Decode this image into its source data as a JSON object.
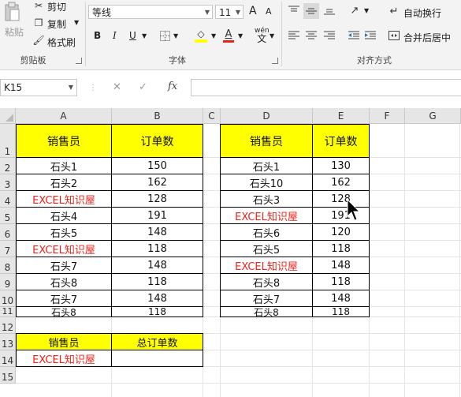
{
  "ribbon": {
    "clipboard": {
      "paste": "粘贴",
      "cut": "剪切",
      "copy": "复制",
      "format_painter": "格式刷",
      "group": "剪贴板"
    },
    "font": {
      "name": "等线",
      "size": "11",
      "bold": "B",
      "italic": "I",
      "underline": "U",
      "grow": "A",
      "shrink": "A",
      "wen": "wén",
      "wen_char": "文",
      "group": "字体"
    },
    "alignment": {
      "wrap": "自动换行",
      "merge": "合并后居中",
      "group": "对齐方式"
    },
    "colors": {
      "fill": "#ffff00",
      "font": "#e8231b"
    }
  },
  "formula_bar": {
    "name_box": "K15",
    "fx": "fx",
    "cancel": "✕",
    "enter": "✓",
    "value": ""
  },
  "columns": [
    "A",
    "B",
    "C",
    "D",
    "E",
    "F",
    "G"
  ],
  "rows": [
    "1",
    "2",
    "3",
    "4",
    "5",
    "6",
    "7",
    "8",
    "9",
    "10",
    "11",
    "12",
    "13",
    "14",
    "15"
  ],
  "table1": {
    "headers": [
      "销售员",
      "订单数"
    ],
    "rows": [
      [
        "石头1",
        "150"
      ],
      [
        "石头2",
        "162"
      ],
      [
        "EXCEL知识屋",
        "128"
      ],
      [
        "石头4",
        "191"
      ],
      [
        "石头5",
        "148"
      ],
      [
        "EXCEL知识屋",
        "118"
      ],
      [
        "石头7",
        "148"
      ],
      [
        "石头8",
        "118"
      ],
      [
        "石头7",
        "148"
      ],
      [
        "石头8",
        "118"
      ]
    ]
  },
  "table2": {
    "headers": [
      "销售员",
      "订单数"
    ],
    "rows": [
      [
        "石头1",
        "130"
      ],
      [
        "石头10",
        "162"
      ],
      [
        "石头3",
        "128"
      ],
      [
        "EXCEL知识屋",
        "191"
      ],
      [
        "石头6",
        "120"
      ],
      [
        "石头5",
        "118"
      ],
      [
        "EXCEL知识屋",
        "148"
      ],
      [
        "石头8",
        "118"
      ],
      [
        "石头7",
        "148"
      ],
      [
        "石头8",
        "118"
      ]
    ]
  },
  "lookup": {
    "headers": [
      "销售员",
      "总订单数"
    ],
    "name": "EXCEL知识屋",
    "total": ""
  },
  "styles": {
    "header_fill": "#ffff00",
    "highlight_text": "#e8231b",
    "highlight_value": "EXCEL知识屋"
  }
}
